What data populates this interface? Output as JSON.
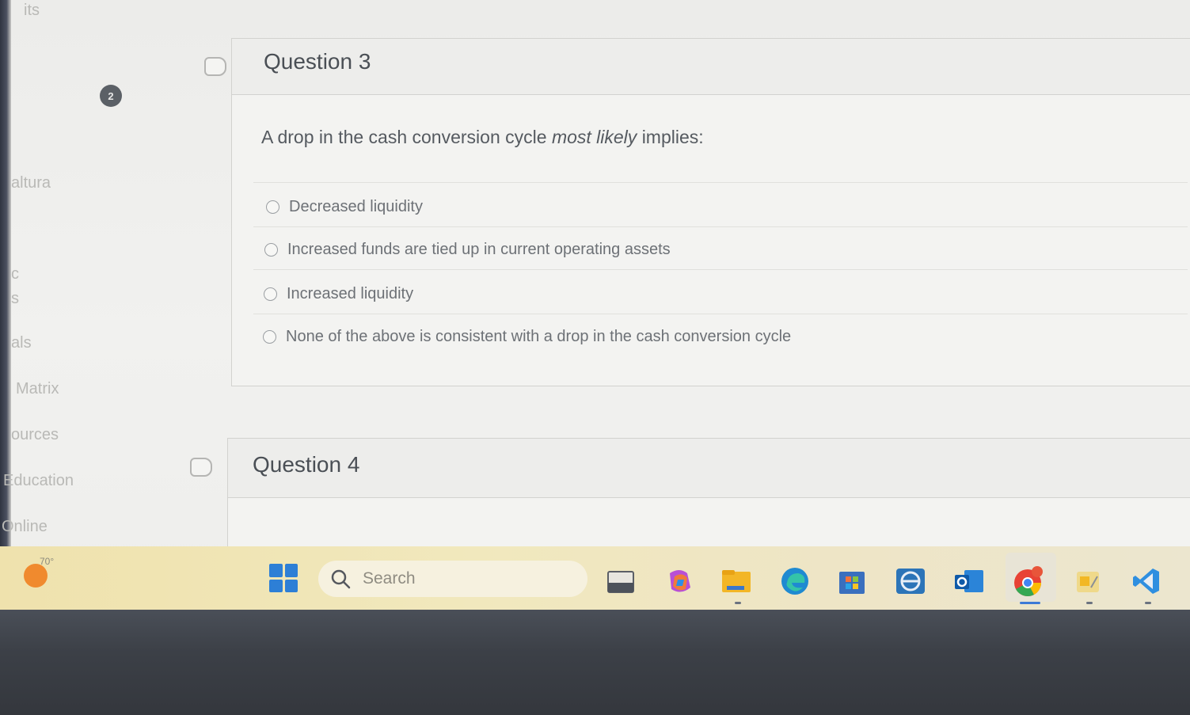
{
  "nav": {
    "badge": "2",
    "items": [
      "its",
      "altura",
      "c",
      "s",
      "als",
      "Matrix",
      "ources",
      "Education",
      "Online"
    ]
  },
  "question3": {
    "title": "Question 3",
    "prompt_before": "A drop in the cash conversion cycle",
    "prompt_emphasis": "most likely",
    "prompt_after": "implies:",
    "answers": [
      "Decreased liquidity",
      "Increased funds are tied up in current operating assets",
      "Increased liquidity",
      "None of the above is consistent with a drop in the cash conversion cycle"
    ]
  },
  "question4": {
    "title": "Question 4"
  },
  "taskbar": {
    "weather_temp": "70°",
    "search_placeholder": "Search",
    "apps": [
      "file-manager-icon",
      "copilot-icon",
      "file-explorer-icon",
      "edge-icon",
      "store-icon",
      "remote-app-icon",
      "outlook-icon",
      "chrome-icon",
      "paint-icon",
      "vscode-icon"
    ]
  },
  "colors": {
    "accent_blue": "#2d7fd6",
    "page_bg": "#f1f1ef",
    "taskbar_bg": "#efe2ad"
  }
}
